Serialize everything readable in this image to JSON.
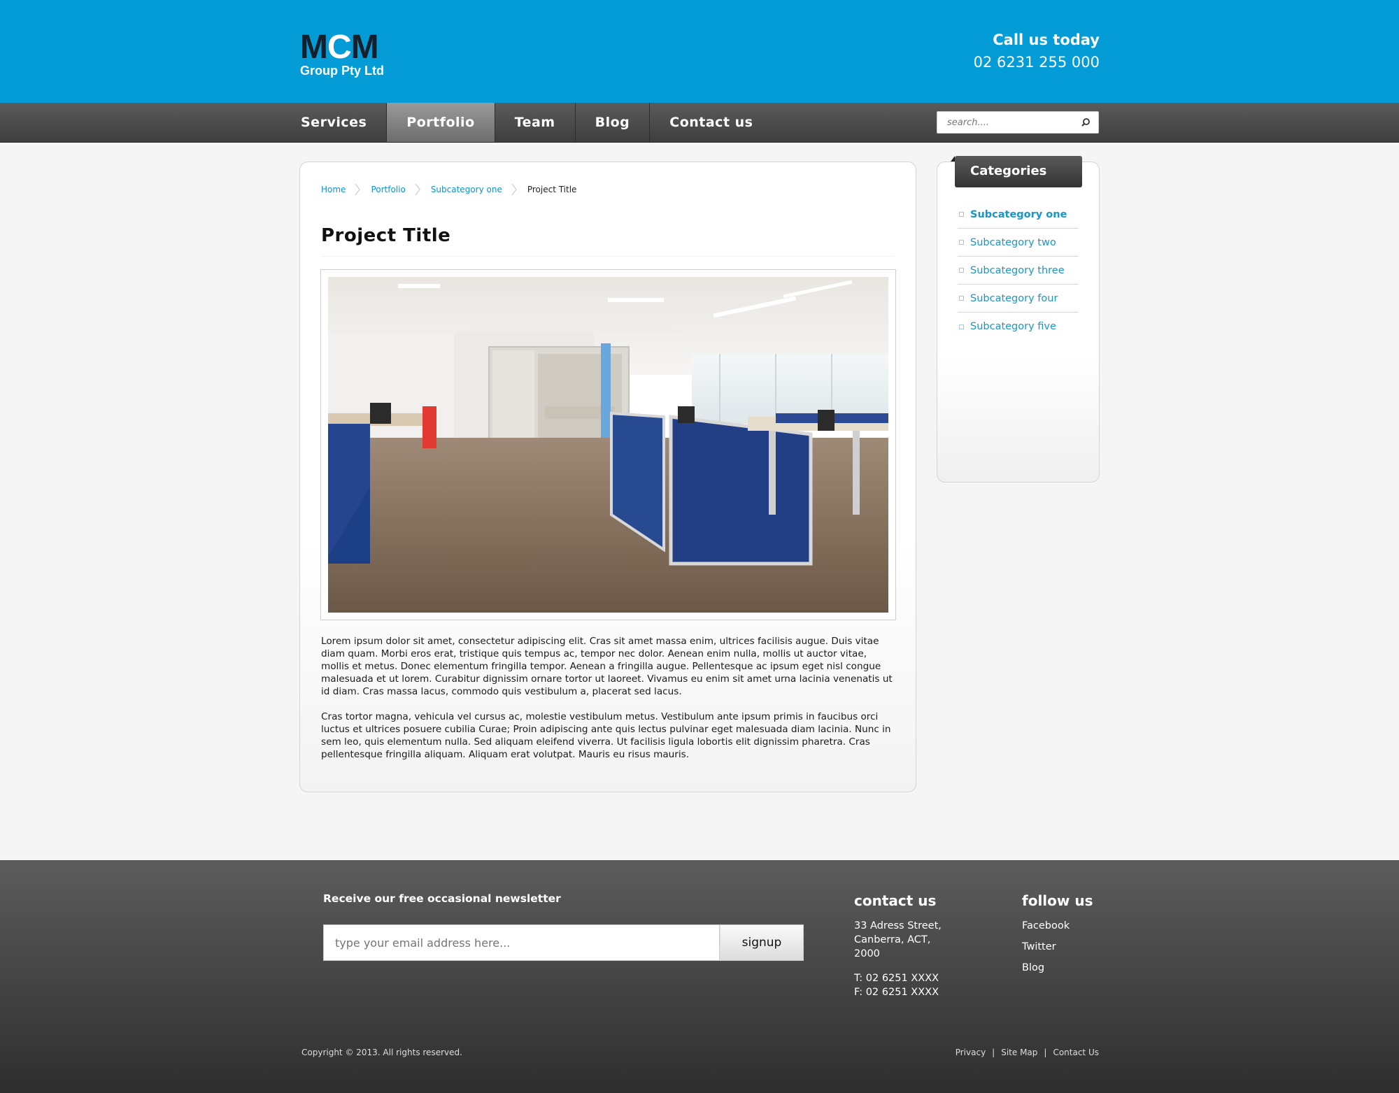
{
  "header": {
    "logo_top": "MCM",
    "logo_sub": "Group Pty Ltd",
    "call_label": "Call us today",
    "phone": "02 6231 255 000"
  },
  "nav": {
    "items": [
      "Services",
      "Portfolio",
      "Team",
      "Blog",
      "Contact us"
    ],
    "active": "Portfolio",
    "search_placeholder": "search...."
  },
  "breadcrumb": {
    "home": "Home",
    "portfolio": "Portfolio",
    "subcategory": "Subcategory one",
    "current": "Project Title"
  },
  "main": {
    "title": "Project Title",
    "paragraphs": [
      "Lorem ipsum dolor sit amet, consectetur adipiscing elit. Cras sit amet massa enim, ultrices facilisis augue. Duis vitae diam quam. Morbi eros erat, tristique quis tempus ac, tempor nec dolor. Aenean enim nulla, mollis ut auctor vitae, mollis et metus. Donec elementum fringilla tempor. Aenean a fringilla augue. Pellentesque ac ipsum eget nisl congue malesuada et ut lorem. Curabitur dignissim ornare tortor ut laoreet. Vivamus eu enim sit amet urna lacinia venenatis ut id diam. Cras massa lacus, commodo quis vestibulum a, placerat sed lacus.",
      "Cras tortor magna, vehicula vel cursus ac, molestie vestibulum metus. Vestibulum ante ipsum primis in faucibus orci luctus et ultrices posuere cubilia Curae; Proin adipiscing ante quis lectus pulvinar eget malesuada diam lacinia. Nunc in sem leo, quis elementum nulla. Sed aliquam eleifend viverra. Ut facilisis ligula lobortis elit dignissim pharetra. Cras pellentesque fringilla aliquam. Aliquam erat volutpat. Mauris eu risus mauris."
    ]
  },
  "sidebar": {
    "heading": "Categories",
    "items": [
      "Subcategory one",
      "Subcategory two",
      "Subcategory three",
      "Subcategory four",
      "Subcategory five"
    ],
    "active": "Subcategory one"
  },
  "footer": {
    "newsletter_title": "Receive our free occasional newsletter",
    "email_placeholder": "type your email address here...",
    "signup_label": "signup",
    "contact_heading": "contact us",
    "address_lines": [
      "33 Adress Street,",
      "Canberra, ACT,",
      "2000"
    ],
    "phone": "T: 02 6251 XXXX",
    "fax": "F: 02 6251 XXXX",
    "follow_heading": "follow us",
    "follow_links": [
      "Facebook",
      "Twitter",
      "Blog"
    ],
    "copyright": "Copyright © 2013. All rights reserved.",
    "links": [
      "Privacy",
      "Site Map",
      "Contact Us"
    ]
  },
  "colors": {
    "brand_blue": "#039cd6",
    "link_blue": "#1996c9",
    "nav_dark": "#3e3e3e"
  }
}
